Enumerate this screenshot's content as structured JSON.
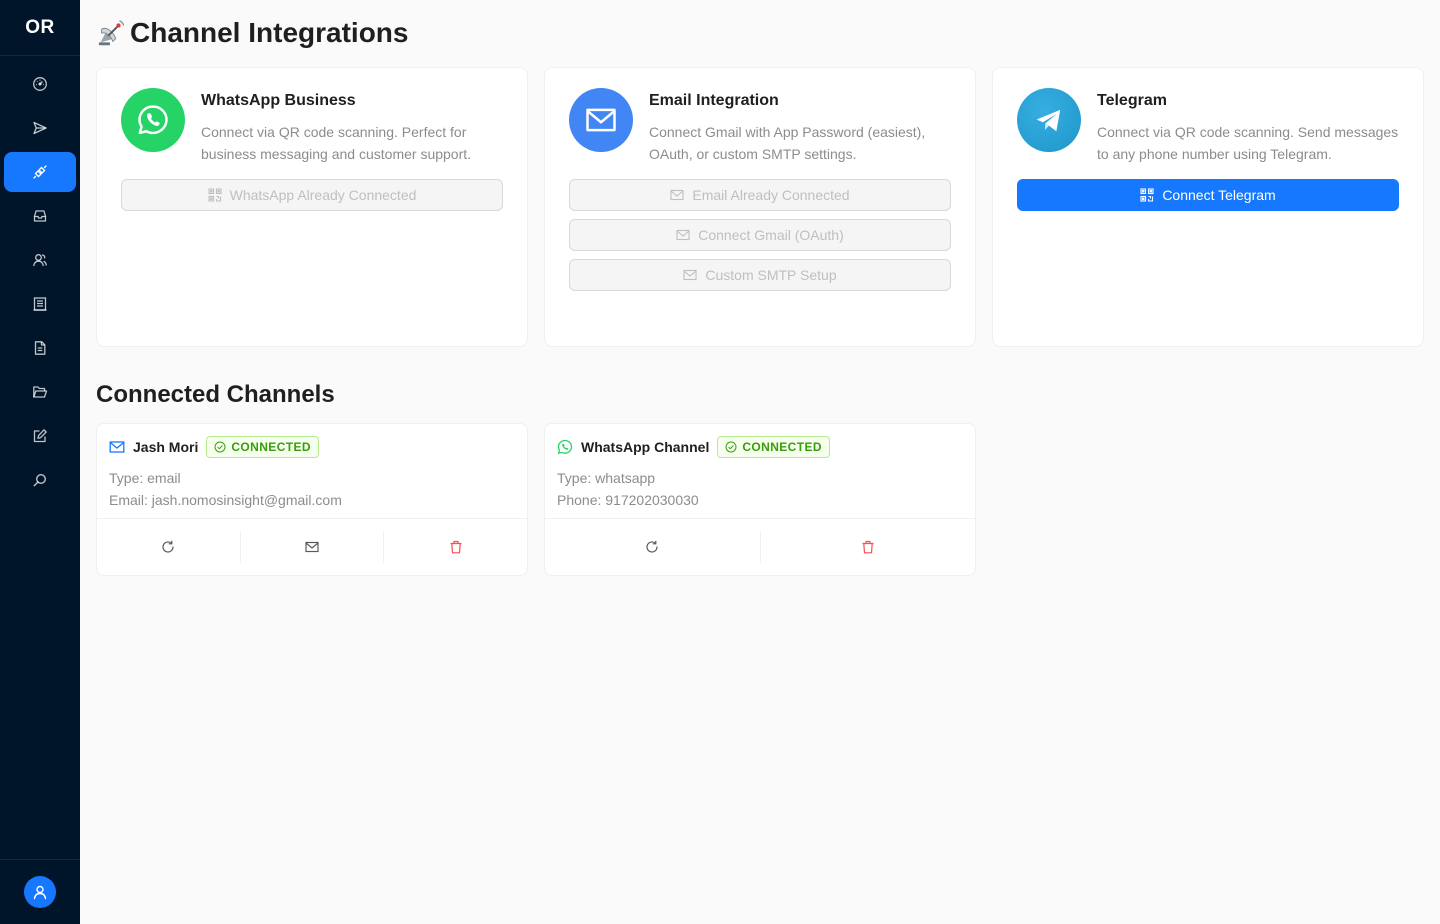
{
  "app": {
    "logo": "OR"
  },
  "sidebar": {
    "items": [
      {
        "icon": "dashboard-icon"
      },
      {
        "icon": "send-icon"
      },
      {
        "icon": "integration-link-icon",
        "active": true
      },
      {
        "icon": "inbox-icon"
      },
      {
        "icon": "contacts-icon"
      },
      {
        "icon": "building-icon"
      },
      {
        "icon": "file-icon"
      },
      {
        "icon": "folder-open-icon"
      },
      {
        "icon": "edit-icon"
      },
      {
        "icon": "search-icon"
      }
    ],
    "user_icon": "user-icon"
  },
  "page": {
    "title": "Channel Integrations",
    "title_icon": "satellite-antenna-emoji"
  },
  "integrations": [
    {
      "title": "WhatsApp Business",
      "description": "Connect via QR code scanning. Perfect for business messaging and customer support.",
      "color": "#25d366",
      "buttons": [
        {
          "label": "WhatsApp Already Connected",
          "icon": "qrcode-icon",
          "disabled": true
        }
      ]
    },
    {
      "title": "Email Integration",
      "description": "Connect Gmail with App Password (easiest), OAuth, or custom SMTP settings.",
      "color": "#4285f4",
      "buttons": [
        {
          "label": "Email Already Connected",
          "icon": "mail-icon",
          "disabled": true
        },
        {
          "label": "Connect Gmail (OAuth)",
          "icon": "mail-icon",
          "disabled": true
        },
        {
          "label": "Custom SMTP Setup",
          "icon": "mail-icon",
          "disabled": true
        }
      ]
    },
    {
      "title": "Telegram",
      "description": "Connect via QR code scanning. Send messages to any phone number using Telegram.",
      "color": "#229ed9",
      "buttons": [
        {
          "label": "Connect Telegram",
          "icon": "qrcode-icon",
          "disabled": false
        }
      ]
    }
  ],
  "connected": {
    "title": "Connected Channels",
    "channels": [
      {
        "name": "Jash Mori",
        "status": "CONNECTED",
        "icon": "mail-icon",
        "lines": [
          "Type: email",
          "Email: jash.nomosinsight@gmail.com"
        ],
        "actions": [
          "reload-icon",
          "mail-icon",
          "delete-icon"
        ]
      },
      {
        "name": "WhatsApp Channel",
        "status": "CONNECTED",
        "icon": "whatsapp-icon",
        "lines": [
          "Type: whatsapp",
          "Phone: 917202030030"
        ],
        "actions": [
          "reload-icon",
          "delete-icon"
        ]
      }
    ]
  },
  "colors": {
    "sidebar": "#001529",
    "primary": "#1677ff",
    "success": "#389e0d",
    "danger": "#ff4d4f"
  }
}
